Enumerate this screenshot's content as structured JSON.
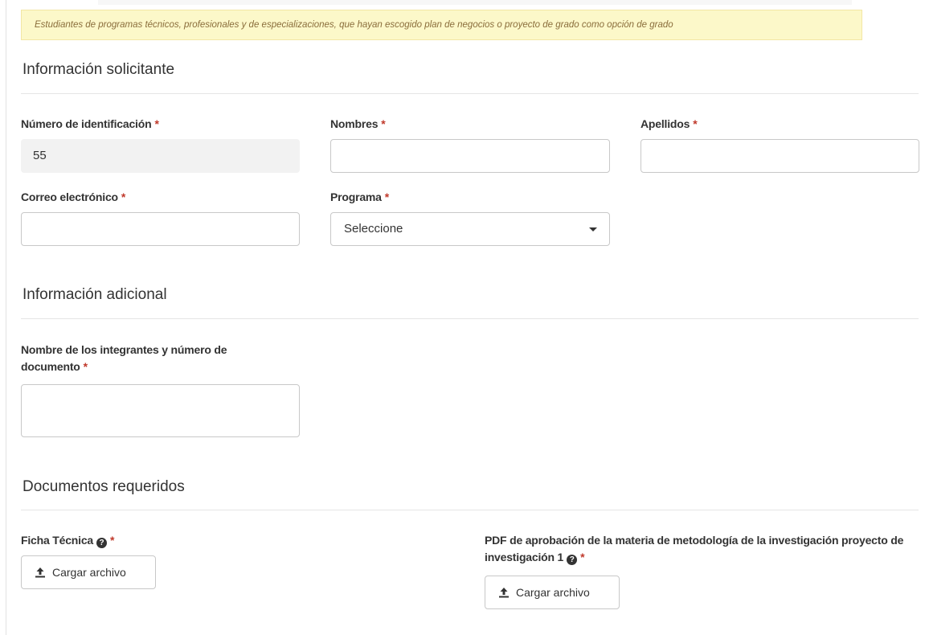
{
  "notice": {
    "text": "Estudiantes de programas técnicos, profesionales y de especializaciones, que hayan escogido plan de negocios o proyecto de grado como opción de grado"
  },
  "sections": {
    "applicant": "Información solicitante",
    "additional": "Información adicional",
    "documents": "Documentos requeridos"
  },
  "required_marker": "*",
  "help_icon_glyph": "?",
  "fields": {
    "id_number": {
      "label": "Número de identificación",
      "value": "55"
    },
    "first_names": {
      "label": "Nombres",
      "value": ""
    },
    "last_names": {
      "label": "Apellidos",
      "value": ""
    },
    "email": {
      "label": "Correo electrónico",
      "value": ""
    },
    "program": {
      "label": "Programa",
      "selected": "Seleccione"
    },
    "members": {
      "label": "Nombre de los integrantes y número de documento",
      "value": ""
    }
  },
  "documents": {
    "technical_sheet": {
      "label": "Ficha Técnica",
      "button": "Cargar archivo"
    },
    "approval_pdf": {
      "label": "PDF de aprobación de la materia de metodología de la investigación proyecto de investigación 1",
      "button": "Cargar archivo"
    }
  },
  "icons": {
    "upload": "upload-icon",
    "help": "question-circle-icon",
    "dropdown": "caret-down-icon"
  }
}
